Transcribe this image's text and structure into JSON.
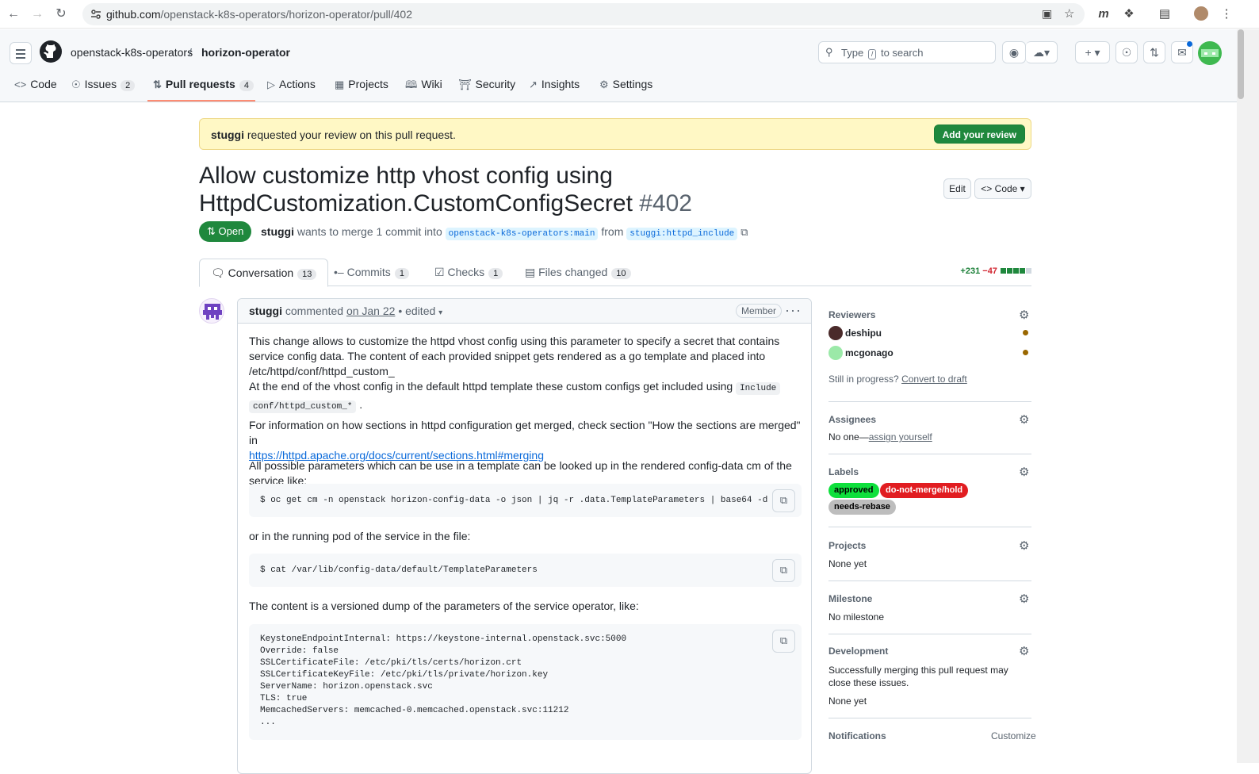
{
  "browser": {
    "url_host": "github.com",
    "url_path": "/openstack-k8s-operators/horizon-operator/pull/402"
  },
  "header": {
    "owner": "openstack-k8s-operators",
    "separator": "/",
    "repo": "horizon-operator",
    "search_prefix": "Type",
    "search_key": "/",
    "search_suffix": "to search"
  },
  "repo_tabs": [
    {
      "label": "Code",
      "icon": "code-icon"
    },
    {
      "label": "Issues",
      "count": "2",
      "icon": "issue-icon"
    },
    {
      "label": "Pull requests",
      "count": "4",
      "icon": "pr-icon"
    },
    {
      "label": "Actions",
      "icon": "play-icon"
    },
    {
      "label": "Projects",
      "icon": "table-icon"
    },
    {
      "label": "Wiki",
      "icon": "book-icon"
    },
    {
      "label": "Security",
      "icon": "shield-icon"
    },
    {
      "label": "Insights",
      "icon": "graph-icon"
    },
    {
      "label": "Settings",
      "icon": "gear-icon"
    }
  ],
  "banner": {
    "user": "stuggi",
    "text": " requested your review on this pull request.",
    "button": "Add your review"
  },
  "pr": {
    "title": "Allow customize http vhost config using HttpdCustomization.CustomConfigSecret",
    "number": "#402",
    "edit": "Edit",
    "code": "Code",
    "state": "Open",
    "author": "stuggi",
    "merge_text": " wants to merge 1 commit into ",
    "base": "openstack-k8s-operators:main",
    "from": " from ",
    "head": "stuggi:httpd_include"
  },
  "pr_tabs": [
    {
      "label": "Conversation",
      "count": "13"
    },
    {
      "label": "Commits",
      "count": "1"
    },
    {
      "label": "Checks",
      "count": "1"
    },
    {
      "label": "Files changed",
      "count": "10"
    }
  ],
  "diffstat": {
    "additions": "+231",
    "deletions": "−47"
  },
  "comment": {
    "author": "stuggi",
    "verb": " commented ",
    "date": "on Jan 22",
    "edited": " • edited",
    "role": "Member",
    "p1": "This change allows to customize the httpd vhost config using this parameter to specify a secret that contains service config data. The content of each provided snippet gets rendered as a go template and placed into /etc/httpd/conf/httpd_custom_",
    "p1_tail": ".",
    "p2_a": "At the end of the vhost config in the default httpd template these custom configs get included using ",
    "p2_code1": "Include",
    "p2_code2": "conf/httpd_custom_*",
    "p2_b": " .",
    "p3": "For information on how sections in httpd configuration get merged, check section \"How the sections are merged\" in",
    "p3_link": "https://httpd.apache.org/docs/current/sections.html#merging",
    "p4": "All possible parameters which can be use in a template can be looked up in the rendered config-data cm of the service like:",
    "cmd1": "$ oc get cm -n openstack horizon-config-data -o json | jq -r .data.TemplateParameters | base64 -d",
    "p5": "or in the running pod of the service in the file:",
    "cmd2": "$ cat /var/lib/config-data/default/TemplateParameters",
    "p6": "The content is a versioned dump of the parameters of the service operator, like:",
    "dump": "KeystoneEndpointInternal: https://keystone-internal.openstack.svc:5000\nOverride: false\nSSLCertificateFile: /etc/pki/tls/certs/horizon.crt\nSSLCertificateKeyFile: /etc/pki/tls/private/horizon.key\nServerName: horizon.openstack.svc\nTLS: true\nMemcachedServers: memcached-0.memcached.openstack.svc:11212\n..."
  },
  "sidebar": {
    "reviewers_title": "Reviewers",
    "reviewers": [
      "deshipu",
      "mcgonago"
    ],
    "in_progress": "Still in progress?",
    "convert": "Convert to draft",
    "assignees_title": "Assignees",
    "assignees_none": "No one—",
    "assign_yourself": "assign yourself",
    "labels_title": "Labels",
    "labels": [
      {
        "name": "approved",
        "color": "#0ee03c"
      },
      {
        "name": "do-not-merge/hold",
        "color": "#e11d21"
      },
      {
        "name": "needs-rebase",
        "color": "#bdbdbd"
      }
    ],
    "projects_title": "Projects",
    "projects_value": "None yet",
    "milestone_title": "Milestone",
    "milestone_value": "No milestone",
    "development_title": "Development",
    "development_text": "Successfully merging this pull request may close these issues.",
    "development_value": "None yet",
    "notifications_title": "Notifications",
    "customize": "Customize"
  }
}
